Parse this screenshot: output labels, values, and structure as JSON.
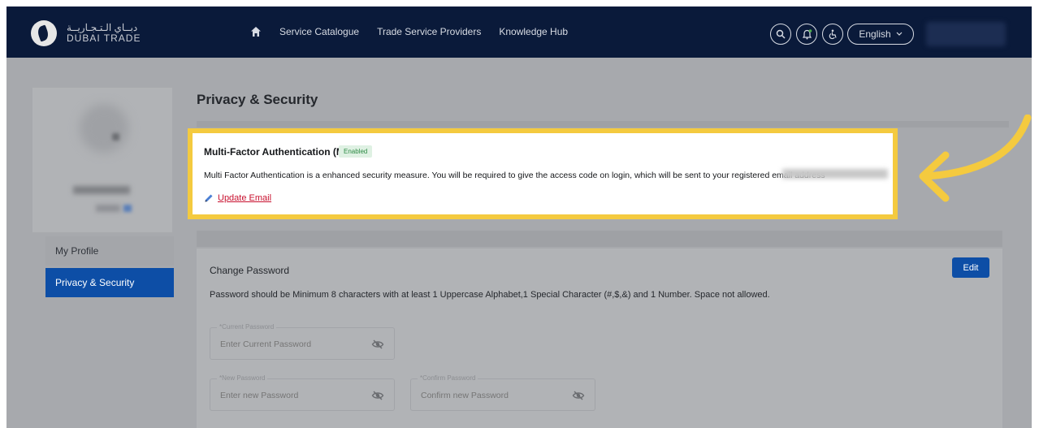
{
  "header": {
    "logo_arabic": "دبــاي الـتـجـاريــة",
    "logo_english": "DUBAI TRADE",
    "nav": [
      "Service Catalogue",
      "Trade Service Providers",
      "Knowledge Hub"
    ],
    "language": "English"
  },
  "sidebar": {
    "items": [
      {
        "label": "My Profile"
      },
      {
        "label": "Privacy & Security"
      }
    ]
  },
  "main": {
    "title": "Privacy & Security",
    "mfa": {
      "title": "Multi-Factor Authentication (MFA)",
      "badge": "Enabled",
      "description": "Multi Factor Authentication is a enhanced security measure. You will be required to give the access code on login, which will be sent to your registered email address",
      "update_label": "Update Email"
    },
    "password": {
      "title": "Change Password",
      "edit_label": "Edit",
      "rule": "Password should be Minimum 8 characters with at least 1 Uppercase Alphabet,1 Special Character (#,$,&) and 1 Number. Space not allowed.",
      "current_label": "*Current Password",
      "current_placeholder": "Enter Current Password",
      "new_label": "*New Password",
      "new_placeholder": "Enter new Password",
      "confirm_label": "*Confirm Password",
      "confirm_placeholder": "Confirm new Password"
    }
  },
  "colors": {
    "header_bg": "#0a1a3a",
    "accent_blue": "#0d4ea6",
    "highlight_yellow": "#f4ca3f",
    "link_red": "#c8102e",
    "badge_green": "#2e8b45"
  }
}
